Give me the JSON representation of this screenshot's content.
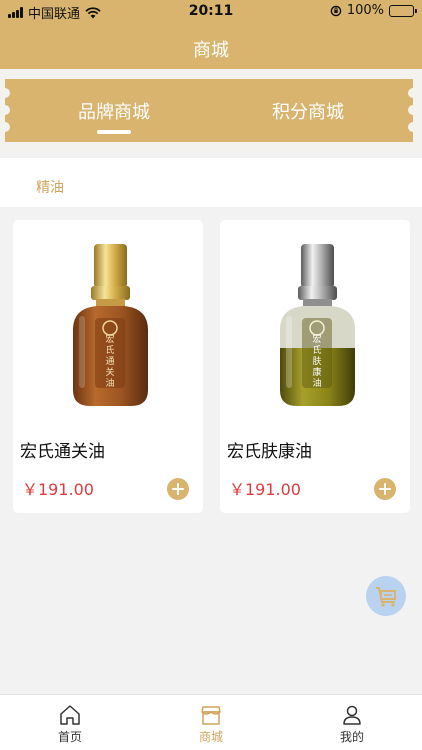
{
  "status_bar": {
    "carrier": "中国联通",
    "time": "20:11",
    "battery": "100%"
  },
  "header": {
    "title": "商城"
  },
  "tabs": [
    {
      "label": "品牌商城",
      "active": true
    },
    {
      "label": "积分商城",
      "active": false
    }
  ],
  "category": {
    "label": "精油"
  },
  "products": [
    {
      "name": "宏氏通关油",
      "price": "￥191.00",
      "image": "amber-oil-bottle"
    },
    {
      "name": "宏氏肤康油",
      "price": "￥191.00",
      "image": "green-oil-bottle"
    }
  ],
  "bottom_nav": [
    {
      "label": "首页",
      "icon": "home-icon"
    },
    {
      "label": "商城",
      "icon": "shop-icon",
      "active": true
    },
    {
      "label": "我的",
      "icon": "user-icon"
    }
  ],
  "colors": {
    "accent": "#d8b46e",
    "price": "#e0393e",
    "category_text": "#d0a45c"
  }
}
